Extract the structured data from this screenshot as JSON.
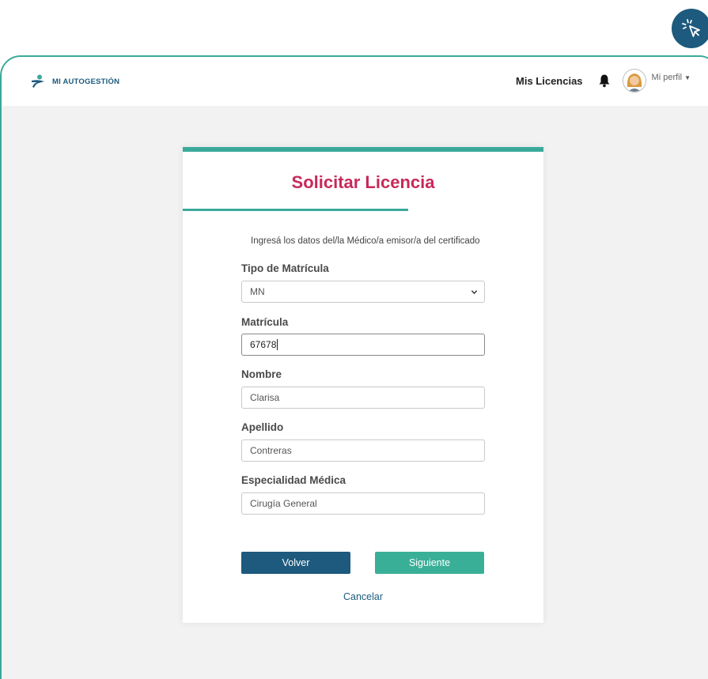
{
  "header": {
    "logo_text": "MI AUTOGESTIÓN",
    "nav_link": "Mis Licencias",
    "profile_label": "Mi perfil",
    "icons": [
      "person-logo-icon",
      "bell-icon",
      "avatar",
      "caret-down-icon",
      "click-cursor-icon"
    ]
  },
  "form": {
    "title": "Solicitar Licencia",
    "intro": "Ingresá los datos del/la Médico/a emisor/a del certificado",
    "tipo_label": "Tipo de Matrícula",
    "tipo_value": "MN",
    "matricula_label": "Matrícula",
    "matricula_value": "67678",
    "nombre_label": "Nombre",
    "nombre_value": "Clarisa",
    "apellido_label": "Apellido",
    "apellido_value": "Contreras",
    "especialidad_label": "Especialidad Médica",
    "especialidad_value": "Cirugía General",
    "back_label": "Volver",
    "next_label": "Siguiente",
    "cancel_label": "Cancelar"
  },
  "colors": {
    "accent": "#3aa99a",
    "title": "#c8295a",
    "primary": "#1d5a7e"
  }
}
